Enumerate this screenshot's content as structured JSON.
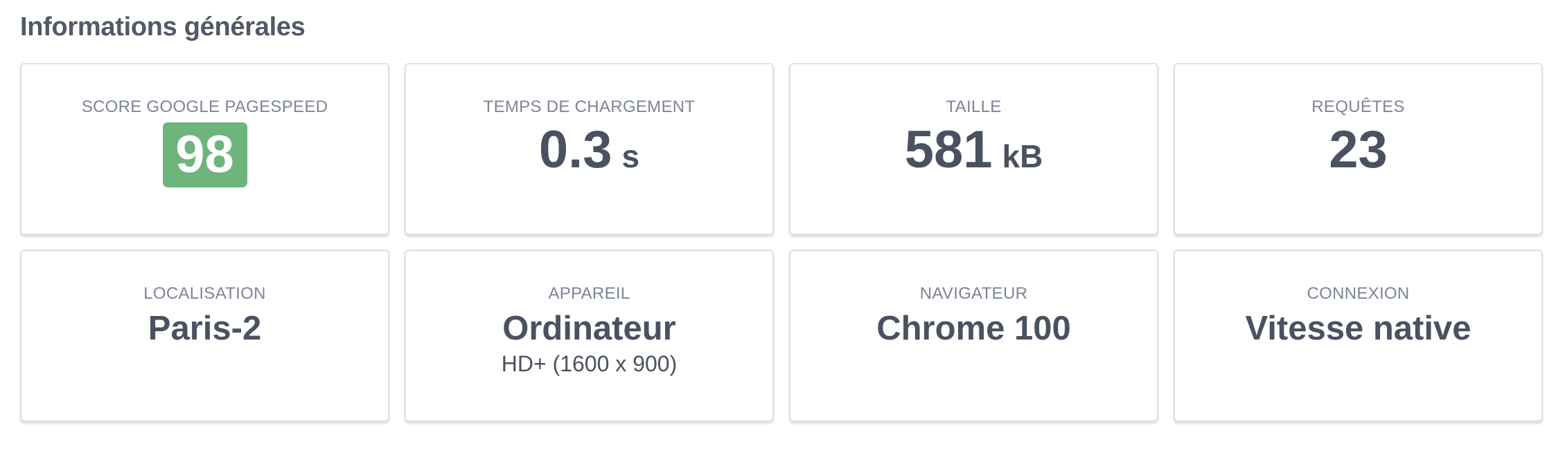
{
  "section": {
    "title": "Informations générales"
  },
  "cards": {
    "score": {
      "label": "SCORE GOOGLE PAGESPEED",
      "value": "98",
      "color": "#6db57c"
    },
    "load_time": {
      "label": "TEMPS DE CHARGEMENT",
      "value": "0.3",
      "unit": "s"
    },
    "size": {
      "label": "TAILLE",
      "value": "581",
      "unit": "kB"
    },
    "requests": {
      "label": "REQUÊTES",
      "value": "23"
    },
    "location": {
      "label": "LOCALISATION",
      "value": "Paris-2"
    },
    "device": {
      "label": "APPAREIL",
      "value": "Ordinateur",
      "detail": "HD+ (1600 x 900)"
    },
    "browser": {
      "label": "NAVIGATEUR",
      "value": "Chrome 100"
    },
    "connection": {
      "label": "CONNEXION",
      "value": "Vitesse native"
    }
  }
}
